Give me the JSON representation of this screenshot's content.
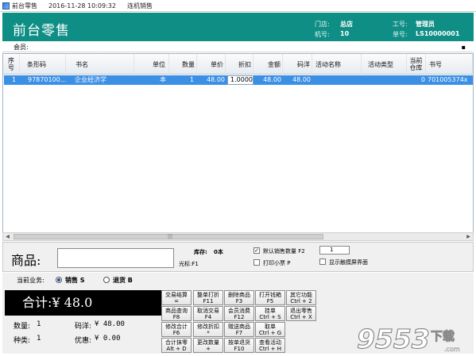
{
  "titlebar": {
    "app_name": "前台零售",
    "datetime": "2016-11-28 10:09:32",
    "mode": "连机销售"
  },
  "header": {
    "title": "前台零售",
    "store_label": "门店:",
    "store_value": "总店",
    "worker_label": "工号:",
    "worker_value": "管理员",
    "machine_label": "机号:",
    "machine_value": "10",
    "order_label": "单号:",
    "order_value": "LS10000001"
  },
  "member": {
    "label": "会员:",
    "value": "",
    "marker": "▪"
  },
  "grid": {
    "columns": [
      "序号",
      "条形码",
      "书名",
      "单位",
      "数量",
      "单价",
      "折扣",
      "金额",
      "码洋",
      "活动名称",
      "活动类型",
      "当前仓库",
      "书号"
    ],
    "rows": [
      {
        "seq": "1",
        "barcode": "97870100...",
        "title": "企业经济学",
        "unit": "本",
        "qty": "1",
        "price": "48.00",
        "discount": "1.0000",
        "amount": "48.00",
        "list_price": "48.00",
        "activity_name": "",
        "activity_type": "",
        "stock": "0",
        "isbn": "701005374x"
      }
    ]
  },
  "entry": {
    "product_label": "商品:",
    "product_value": "",
    "stock_label": "库存:",
    "stock_value": "0本",
    "cursor_label": "光标:F1",
    "default_qty_label": "默认销售数量 F2",
    "default_qty_checked": true,
    "default_qty_value": "1",
    "print_receipt_label": "打印小票 P",
    "print_receipt_checked": false,
    "touch_label": "显示触摸屏界面",
    "touch_checked": false
  },
  "business": {
    "label": "当前业务:",
    "sale_label": "销售 S",
    "return_label": "退货 B",
    "selected": "sale"
  },
  "totals": {
    "total_label": "合计:¥ 48.0",
    "qty_label": "数量:",
    "qty_value": "1",
    "list_label": "码洋:",
    "list_value": "¥ 48.00",
    "kinds_label": "种类:",
    "kinds_value": "1",
    "discount_label": "优惠:",
    "discount_value": "¥ 0.00"
  },
  "function_buttons": [
    {
      "line1": "交易结算",
      "line2": "="
    },
    {
      "line1": "整单打折",
      "line2": "F11"
    },
    {
      "line1": "删除商品",
      "line2": "F3"
    },
    {
      "line1": "打开钱箱",
      "line2": "F5"
    },
    {
      "line1": "其它功能",
      "line2": "Ctrl + 2"
    },
    {
      "line1": "商品查询",
      "line2": "F8"
    },
    {
      "line1": "取消交易",
      "line2": "F4"
    },
    {
      "line1": "会员消费",
      "line2": "F12"
    },
    {
      "line1": "挂单",
      "line2": "Ctrl + S"
    },
    {
      "line1": "退出零售",
      "line2": "Ctrl + X"
    },
    {
      "line1": "修改合计",
      "line2": "F6"
    },
    {
      "line1": "修改折扣",
      "line2": "*"
    },
    {
      "line1": "赠送商品",
      "line2": "F7"
    },
    {
      "line1": "取单",
      "line2": "Ctrl + G"
    },
    {
      "line1": "合计抹零",
      "line2": "Alt + D"
    },
    {
      "line1": "更改数量",
      "line2": "+"
    },
    {
      "line1": "按单退货",
      "line2": "F10"
    },
    {
      "line1": "查看活动",
      "line2": "Ctrl + H"
    }
  ],
  "watermark": {
    "text": "9553",
    "suffix": "下载",
    "domain": ".com"
  },
  "colors": {
    "header_bg": "#0f8e86",
    "selected_row": "#3b8fe5",
    "total_bg": "#000000"
  }
}
